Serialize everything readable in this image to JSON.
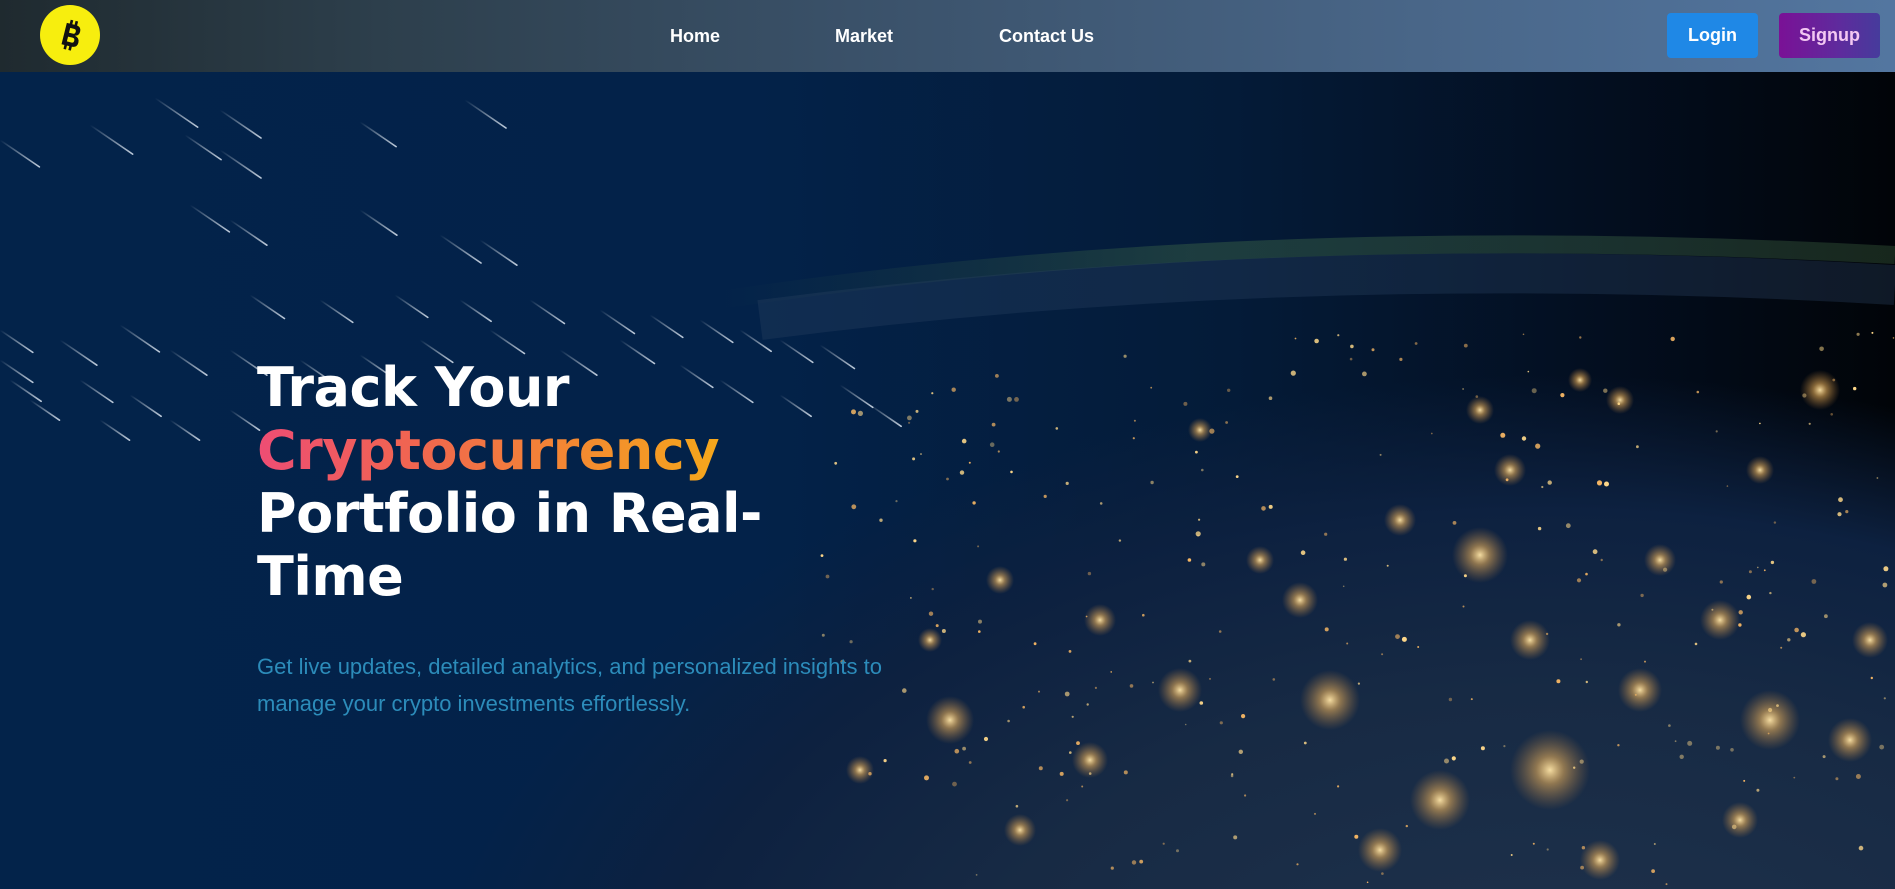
{
  "navbar": {
    "logo_icon": "bitcoin-icon",
    "logo_color": "#f7ee0e",
    "links": [
      {
        "label": "Home"
      },
      {
        "label": "Market"
      },
      {
        "label": "Contact Us"
      }
    ],
    "login_label": "Login",
    "signup_label": "Signup",
    "login_color": "#1f88e6",
    "signup_color": "#7a1196"
  },
  "hero": {
    "headline_line1": "Track Your",
    "headline_highlight": "Cryptocurrency",
    "headline_line3": "Portfolio in Real-",
    "headline_line4": "Time",
    "subtitle": "Get live updates, detailed analytics, and personalized insights to manage your crypto investments effortlessly.",
    "highlight_gradient": [
      "#ee4d74",
      "#f5a71b"
    ],
    "subtitle_color": "#2c8cba"
  }
}
